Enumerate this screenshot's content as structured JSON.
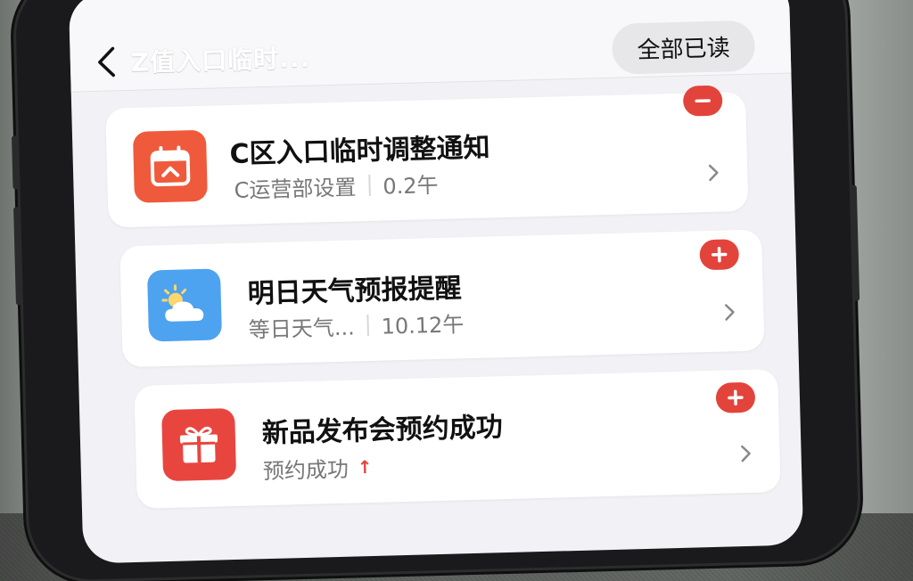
{
  "header": {
    "title": "Z值入口临时...",
    "mark_all_read": "全部已读"
  },
  "notifications": [
    {
      "title": "C区入口临时调整通知",
      "source": "C运营部设置",
      "time": "0.2午",
      "icon": "calendar-icon",
      "icon_color": "#ef5a3c",
      "badge": "minus"
    },
    {
      "title": "明日天气预报提醒",
      "source": "等日天气...",
      "time": "10.12午",
      "icon": "weather-icon",
      "icon_color": "#4da3ef",
      "badge": "plus"
    },
    {
      "title": "新品发布会预约成功",
      "source": "预约成功",
      "time": "",
      "icon": "gift-icon",
      "icon_color": "#e9453f",
      "badge": "plus"
    }
  ],
  "colors": {
    "badge_red": "#e2443c",
    "screen_bg": "#f2f2f6"
  }
}
